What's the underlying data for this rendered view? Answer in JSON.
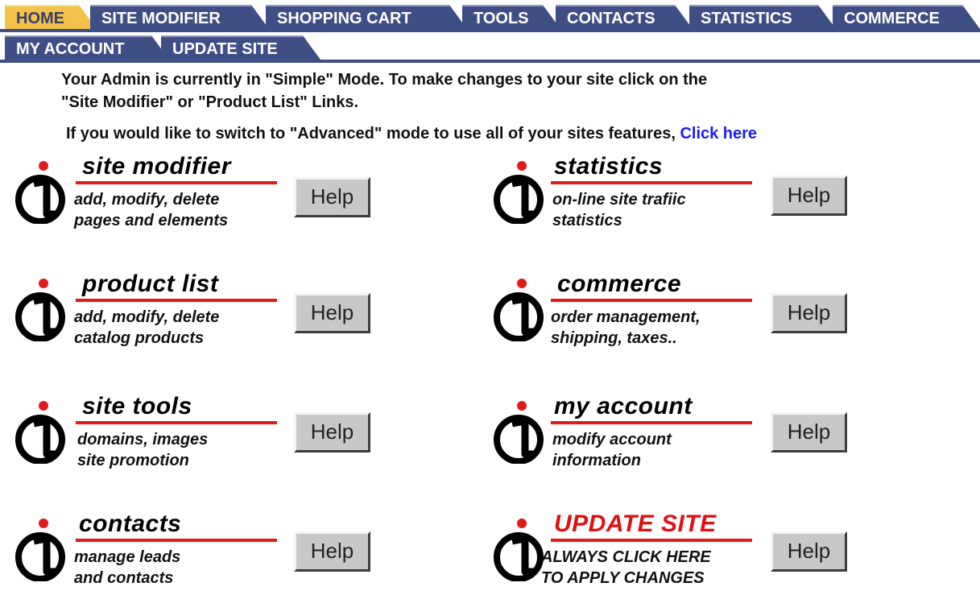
{
  "tabs": {
    "home": "HOME",
    "site_modifier": "SITE MODIFIER",
    "shopping_cart": "SHOPPING CART",
    "tools": "TOOLS",
    "contacts": "CONTACTS",
    "statistics": "STATISTICS",
    "commerce": "COMMERCE",
    "my_account": "MY ACCOUNT",
    "update_site": "UPDATE SITE"
  },
  "intro": {
    "line1": "Your Admin is currently in \"Simple\" Mode. To make changes to your site click on the",
    "line2": "\"Site Modifier\" or \"Product List\" Links.",
    "line3": "If you would like to switch to \"Advanced\" mode to use all of your sites features,",
    "click_here": "Click here"
  },
  "modules": {
    "site_modifier": {
      "title": "site modifier",
      "desc1": "add, modify, delete",
      "desc2": "pages and elements"
    },
    "statistics": {
      "title": "statistics",
      "desc1": "on-line site trafiic",
      "desc2": "statistics"
    },
    "product_list": {
      "title": "product list",
      "desc1": "add, modify, delete",
      "desc2": "catalog products"
    },
    "commerce": {
      "title": "commerce",
      "desc1": "order management,",
      "desc2": "shipping, taxes.."
    },
    "site_tools": {
      "title": "site tools",
      "desc1": "domains, images",
      "desc2": "site promotion"
    },
    "my_account": {
      "title": "my account",
      "desc1": "modify account",
      "desc2": "information"
    },
    "contacts": {
      "title": "contacts",
      "desc1": "manage leads",
      "desc2": "and contacts"
    },
    "update_site": {
      "title": "UPDATE SITE",
      "desc1": "ALWAYS CLICK HERE",
      "desc2": "TO APPLY CHANGES"
    }
  },
  "help_label": "Help",
  "colors": {
    "tab_bg": "#3f4f86",
    "tab_active_bg": "#f2c24a",
    "rule_red": "#e21a1a",
    "link_blue": "#1a1aff",
    "button_gray": "#c8c8c8"
  },
  "icons": {
    "module_logo": "i-logo-icon"
  }
}
